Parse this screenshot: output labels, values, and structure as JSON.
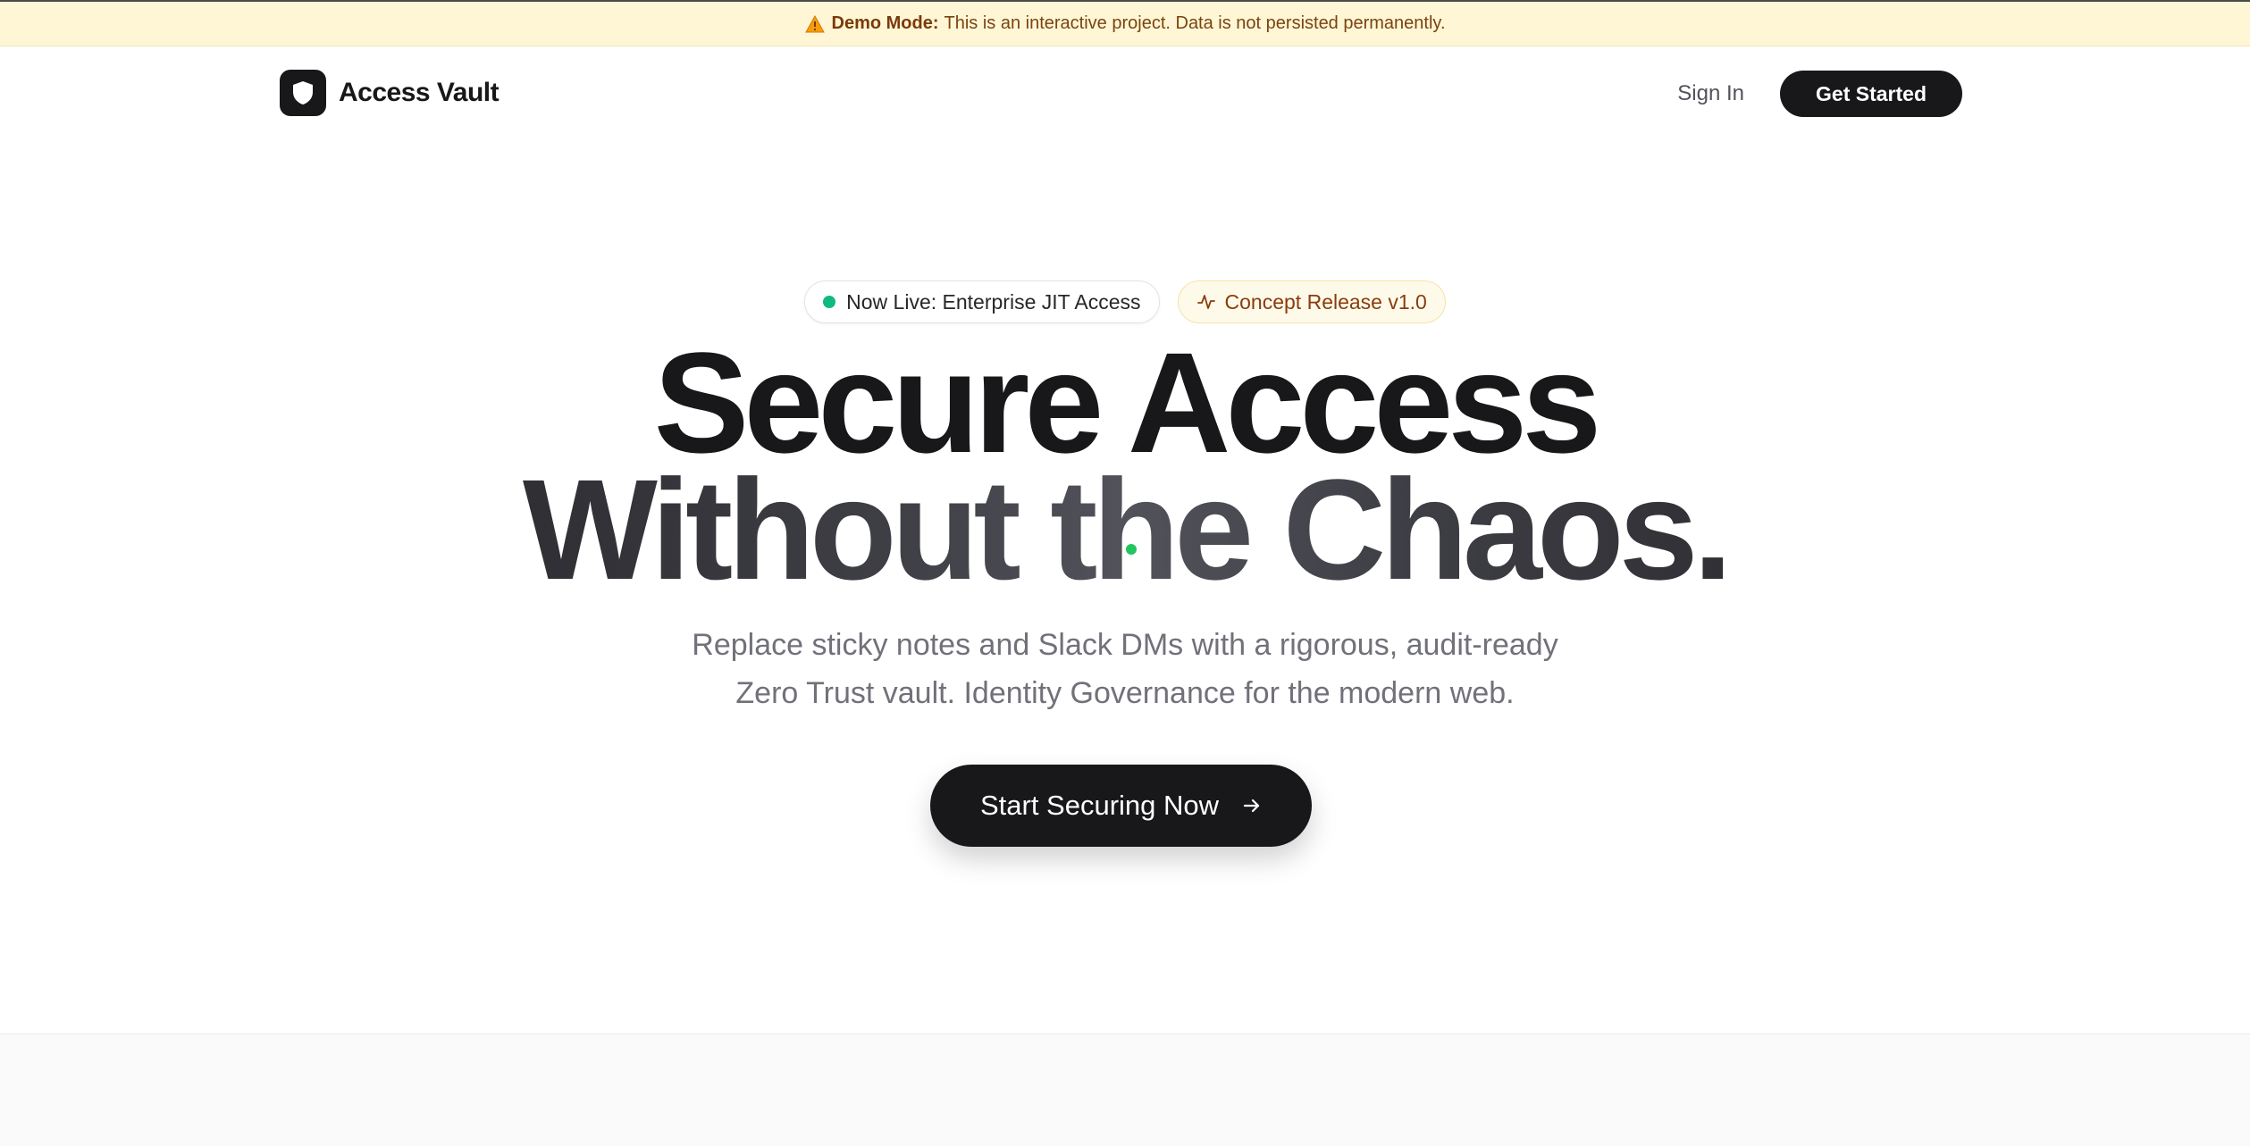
{
  "banner": {
    "label": "Demo Mode:",
    "message": "This is an interactive project. Data is not persisted permanently.",
    "icon": "warning-icon"
  },
  "header": {
    "brand_name": "Access Vault",
    "brand_icon": "shield-icon",
    "signin_label": "Sign In",
    "cta_label": "Get Started"
  },
  "hero": {
    "badge_live": "Now Live: Enterprise JIT Access",
    "badge_release": "Concept Release v1.0",
    "headline_line1": "Secure Access",
    "headline_line2": "Without the Chaos.",
    "subtitle_line1": "Replace sticky notes and Slack DMs with a rigorous, audit-ready",
    "subtitle_line2": "Zero Trust vault. Identity Governance for the modern web.",
    "cta_label": "Start Securing Now"
  },
  "colors": {
    "banner_bg": "#fef6d5",
    "primary": "#18181b",
    "live_dot": "#10b981",
    "release_text": "#8a3c0c"
  }
}
